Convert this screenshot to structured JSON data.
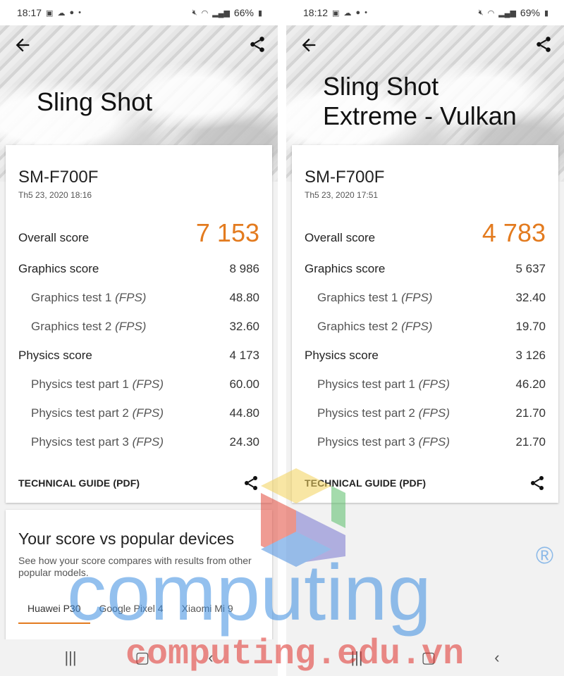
{
  "left": {
    "status": {
      "time": "18:17",
      "battery": "66%"
    },
    "title_lines": [
      "Sling Shot"
    ],
    "device": "SM-F700F",
    "date": "Th5 23, 2020 18:16",
    "overall_label": "Overall score",
    "overall_value": "7 153",
    "graphics_label": "Graphics score",
    "graphics_value": "8 986",
    "gt1_label": "Graphics test 1",
    "gt1_value": "48.80",
    "gt2_label": "Graphics test 2",
    "gt2_value": "32.60",
    "physics_label": "Physics score",
    "physics_value": "4 173",
    "pt1_label": "Physics test part 1",
    "pt1_value": "60.00",
    "pt2_label": "Physics test part 2",
    "pt2_value": "44.80",
    "pt3_label": "Physics test part 3",
    "pt3_value": "24.30",
    "fps": "(FPS)",
    "tech_label": "TECHNICAL GUIDE (PDF)",
    "compare": {
      "title": "Your score vs popular devices",
      "desc": "See how your score compares with results from other popular models.",
      "tabs": [
        "Huawei P30",
        "Google Pixel 4",
        "Xiaomi Mi 9"
      ]
    }
  },
  "right": {
    "status": {
      "time": "18:12",
      "battery": "69%"
    },
    "title_lines": [
      "Sling Shot",
      "Extreme - Vulkan"
    ],
    "device": "SM-F700F",
    "date": "Th5 23, 2020 17:51",
    "overall_label": "Overall score",
    "overall_value": "4 783",
    "graphics_label": "Graphics score",
    "graphics_value": "5 637",
    "gt1_label": "Graphics test 1",
    "gt1_value": "32.40",
    "gt2_label": "Graphics test 2",
    "gt2_value": "19.70",
    "physics_label": "Physics score",
    "physics_value": "3 126",
    "pt1_label": "Physics test part 1",
    "pt1_value": "46.20",
    "pt2_label": "Physics test part 2",
    "pt2_value": "21.70",
    "pt3_label": "Physics test part 3",
    "pt3_value": "21.70",
    "fps": "(FPS)",
    "tech_label": "TECHNICAL GUIDE (PDF)"
  },
  "watermark": {
    "word": "computing",
    "url": "computing.edu.vn",
    "mark": "®"
  },
  "colors": {
    "accent": "#e37b1f",
    "watermark_blue": "#3b8de0",
    "watermark_red": "#e0302a"
  }
}
